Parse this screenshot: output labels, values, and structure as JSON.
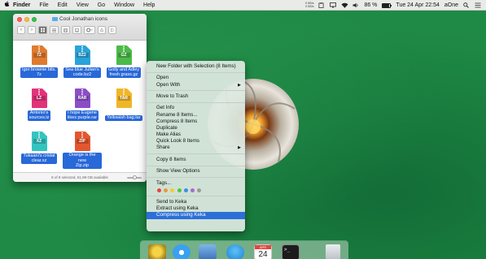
{
  "menubar": {
    "apple": "",
    "items": [
      "Finder",
      "File",
      "Edit",
      "View",
      "Go",
      "Window",
      "Help"
    ],
    "net_up": "0 KB/s",
    "net_down": "0 KB/s",
    "battery": "86 %",
    "battery_level": 0.86,
    "clock": "Tue 24 Apr  22:54",
    "user": "aOne"
  },
  "finder": {
    "title": "Cool Jonathan icons",
    "nav_back": "‹",
    "nav_forward": "›",
    "status": "8 of 8 selected, 51,99 GB available",
    "files": [
      {
        "ext": "7Z",
        "name1": "Igor brownie bits.",
        "name2": "7z",
        "color": "#e07b2e"
      },
      {
        "ext": "BZ2",
        "name1": "Sea blue Julian's",
        "name2": "code.bz2",
        "color": "#2aa3d8"
      },
      {
        "ext": "GZ",
        "name1": "Golly and Adley",
        "name2": "fresh grass.gz",
        "color": "#4cba49"
      },
      {
        "ext": "LZ",
        "name1": "Antonio's",
        "name2": "sources.lz",
        "color": "#e1337a"
      },
      {
        "ext": "RAR",
        "name1": "I hope Eugene",
        "name2": "likes purple.rar",
        "color": "#8b4ec6"
      },
      {
        "ext": "TAR",
        "name1": "Yellowish bag.tar",
        "name2": "",
        "color": "#f0b629"
      },
      {
        "ext": "XZ",
        "name1": "Tukaani's cristal",
        "name2": "clear.xz",
        "color": "#34c4c0"
      },
      {
        "ext": "ZIP",
        "name1": "Orange is the new",
        "name2": "Zip.zip",
        "color": "#e4572e"
      }
    ]
  },
  "context_menu": {
    "new_folder": "New Folder with Selection (8 Items)",
    "open": "Open",
    "open_with": "Open With",
    "move_to_trash": "Move to Trash",
    "get_info": "Get Info",
    "rename": "Rename 8 Items...",
    "compress": "Compress 8 Items",
    "duplicate": "Duplicate",
    "make_alias": "Make Alias",
    "quick_look": "Quick Look 8 Items",
    "share": "Share",
    "copy": "Copy 8 Items",
    "show_view_options": "Show View Options",
    "tags": "Tags...",
    "tag_colors": [
      "#e0473f",
      "#f0953a",
      "#f2cc35",
      "#58c14a",
      "#3b8fe3",
      "#a66bd0",
      "#9a9a9a"
    ],
    "send_to_keka": "Send to Keka",
    "extract_keka": "Extract using Keka",
    "compress_keka": "Compress using Keka",
    "submenu_arrow": "▶"
  },
  "dock": {
    "calendar_month": "APR",
    "calendar_day": "24",
    "terminal_prompt": ">_"
  }
}
